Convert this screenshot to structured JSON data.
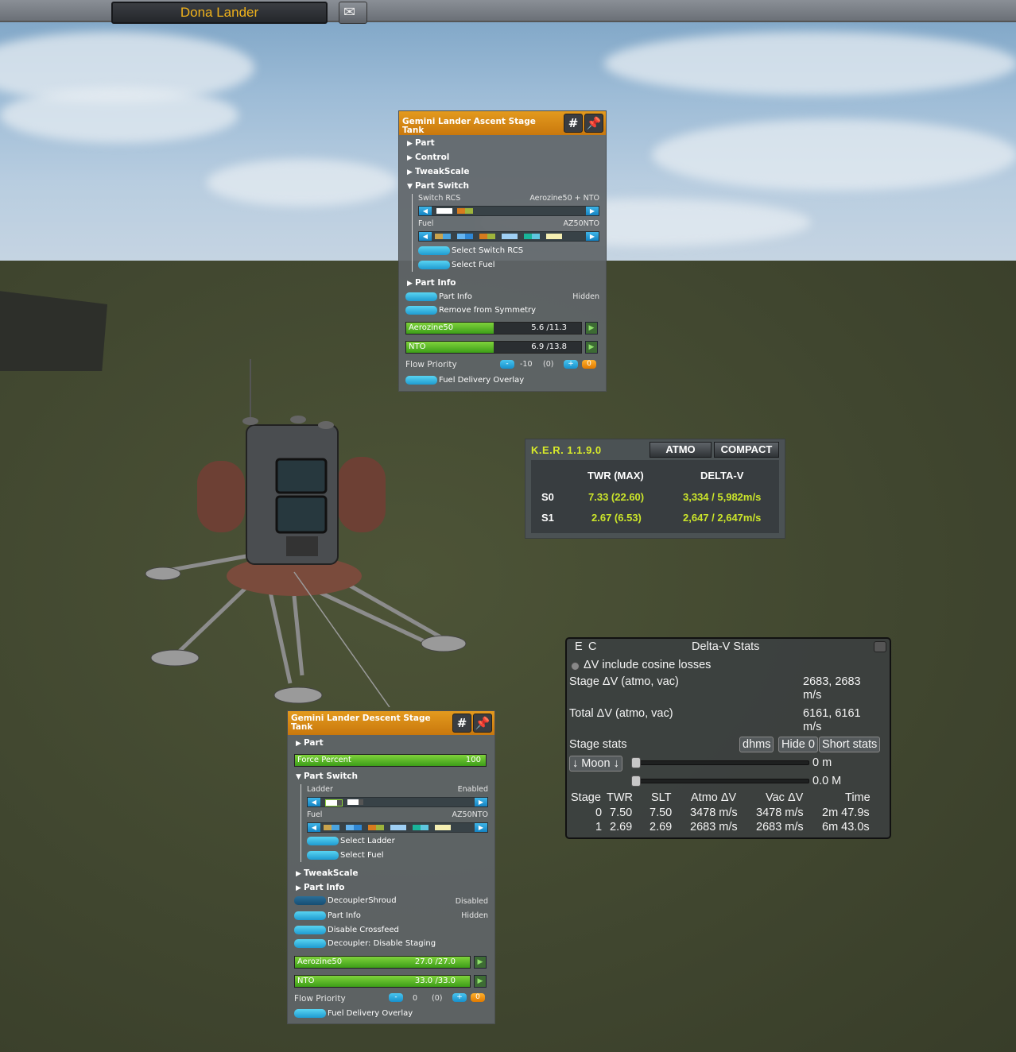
{
  "top_bar": {
    "vessel_name": "Dona Lander",
    "mail_icon": "envelope-icon"
  },
  "paw_ascent": {
    "title": "Gemini Lander Ascent Stage Tank",
    "hash_label": "#",
    "sections": {
      "part": "Part",
      "control": "Control",
      "tweakscale": "TweakScale",
      "part_switch": "Part Switch",
      "part_info": "Part Info"
    },
    "switch_rcs_label": "Switch RCS",
    "switch_rcs_value": "Aerozine50 + NTO",
    "fuel_label": "Fuel",
    "fuel_value": "AZ50NTO",
    "select_switch_rcs": "Select Switch RCS",
    "select_fuel": "Select Fuel",
    "part_info_btn": "Part Info",
    "part_info_state": "Hidden",
    "remove_symmetry": "Remove from Symmetry",
    "resources": [
      {
        "name": "Aerozine50",
        "value": "5.6 /11.3",
        "fill": 0.5
      },
      {
        "name": "NTO",
        "value": "6.9 /13.8",
        "fill": 0.5
      }
    ],
    "flow_priority_label": "Flow Priority",
    "flow_minus": "-",
    "flow_value": "-10",
    "flow_paren": "(0)",
    "flow_plus": "+",
    "flow_zero": "0",
    "fuel_overlay": "Fuel Delivery Overlay"
  },
  "paw_descent": {
    "title": "Gemini Lander Descent Stage Tank",
    "hash_label": "#",
    "sections": {
      "part": "Part",
      "part_switch": "Part Switch",
      "tweakscale": "TweakScale",
      "part_info": "Part Info"
    },
    "force_percent_label": "Force Percent",
    "force_percent_value": "100",
    "force_percent_fill": 1.0,
    "ladder_label": "Ladder",
    "ladder_value": "Enabled",
    "fuel_label": "Fuel",
    "fuel_value": "AZ50NTO",
    "select_ladder": "Select Ladder",
    "select_fuel": "Select Fuel",
    "decoupler_shroud": "DecouplerShroud",
    "decoupler_shroud_state": "Disabled",
    "part_info_btn": "Part Info",
    "part_info_state": "Hidden",
    "disable_crossfeed": "Disable Crossfeed",
    "decoupler_disable_staging": "Decoupler: Disable Staging",
    "resources": [
      {
        "name": "Aerozine50",
        "value": "27.0 /27.0",
        "fill": 1.0
      },
      {
        "name": "NTO",
        "value": "33.0 /33.0",
        "fill": 1.0
      }
    ],
    "flow_priority_label": "Flow Priority",
    "flow_minus": "-",
    "flow_value": "0",
    "flow_paren": "(0)",
    "flow_plus": "+",
    "flow_zero": "0",
    "fuel_overlay": "Fuel Delivery Overlay"
  },
  "ker": {
    "version": "K.E.R. 1.1.9.0",
    "atmo_btn": "ATMO",
    "compact_btn": "COMPACT",
    "col_twr": "TWR (MAX)",
    "col_dv": "DELTA-V",
    "rows": [
      {
        "stage": "S0",
        "twr": "7.33 (22.60)",
        "dv": "3,334 / 5,982m/s"
      },
      {
        "stage": "S1",
        "twr": "2.67 (6.53)",
        "dv": "2,647 / 2,647m/s"
      }
    ]
  },
  "dv_stats": {
    "e_label": "E",
    "c_label": "C",
    "title": "Delta-V Stats",
    "cosine_label": "ΔV include cosine losses",
    "stage_dv_label": "Stage ΔV (atmo, vac)",
    "stage_dv_value": "2683, 2683",
    "stage_dv_unit": "m/s",
    "total_dv_label": "Total ΔV (atmo, vac)",
    "total_dv_value": "6161, 6161",
    "total_dv_unit": "m/s",
    "stage_stats_label": "Stage stats",
    "btn_dhms": "dhms",
    "btn_hide": "Hide 0",
    "btn_short": "Short stats",
    "body_select": "↓ Moon ↓",
    "altitude": "0 m",
    "mach": "0.0 M",
    "table_headers": [
      "Stage",
      "TWR",
      "SLT",
      "Atmo ΔV",
      "Vac ΔV",
      "Time"
    ],
    "table_rows": [
      [
        "0",
        "7.50",
        "7.50",
        "3478 m/s",
        "3478 m/s",
        "2m 47.9s"
      ],
      [
        "1",
        "2.69",
        "2.69",
        "2683 m/s",
        "2683 m/s",
        "6m 43.0s"
      ]
    ]
  },
  "colors": {
    "accent_orange": "#e39a1e",
    "ker_green": "#cbe52a",
    "vessel_gold": "#f0b21b"
  }
}
